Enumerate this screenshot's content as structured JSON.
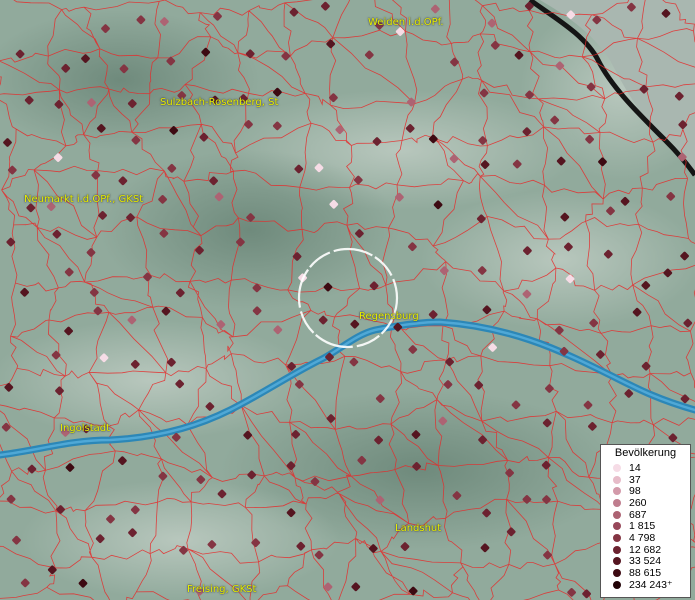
{
  "map": {
    "cities": [
      {
        "name": "Weiden i.d.OPf."
      },
      {
        "name": "Sulzbach-Rosenberg, St"
      },
      {
        "name": "Neumarkt i.d.OPf., GKSt"
      },
      {
        "name": "Regensburg"
      },
      {
        "name": "Ingolstadt"
      },
      {
        "name": "Landshut"
      },
      {
        "name": "Freising, GKSt"
      }
    ]
  },
  "legend": {
    "title": "Bevölkerung",
    "classes": [
      {
        "label": "14",
        "color": "#f6dce6"
      },
      {
        "label": "37",
        "color": "#e7bcc9"
      },
      {
        "label": "98",
        "color": "#d39aaa"
      },
      {
        "label": "260",
        "color": "#bf7d8e"
      },
      {
        "label": "687",
        "color": "#ad6373"
      },
      {
        "label": "1 815",
        "color": "#98485a"
      },
      {
        "label": "4 798",
        "color": "#843543"
      },
      {
        "label": "12 682",
        "color": "#6c2230"
      },
      {
        "label": "33 524",
        "color": "#551520"
      },
      {
        "label": "88 615",
        "color": "#3d0a12"
      },
      {
        "label": "234 243⁺",
        "color": "#220307"
      }
    ]
  },
  "colors": {
    "terrain": "#8fa89a",
    "boundary": "#e52a2a",
    "river": "#2c87b7",
    "label": "#e8f000",
    "selection_circle": "#ffffff"
  }
}
